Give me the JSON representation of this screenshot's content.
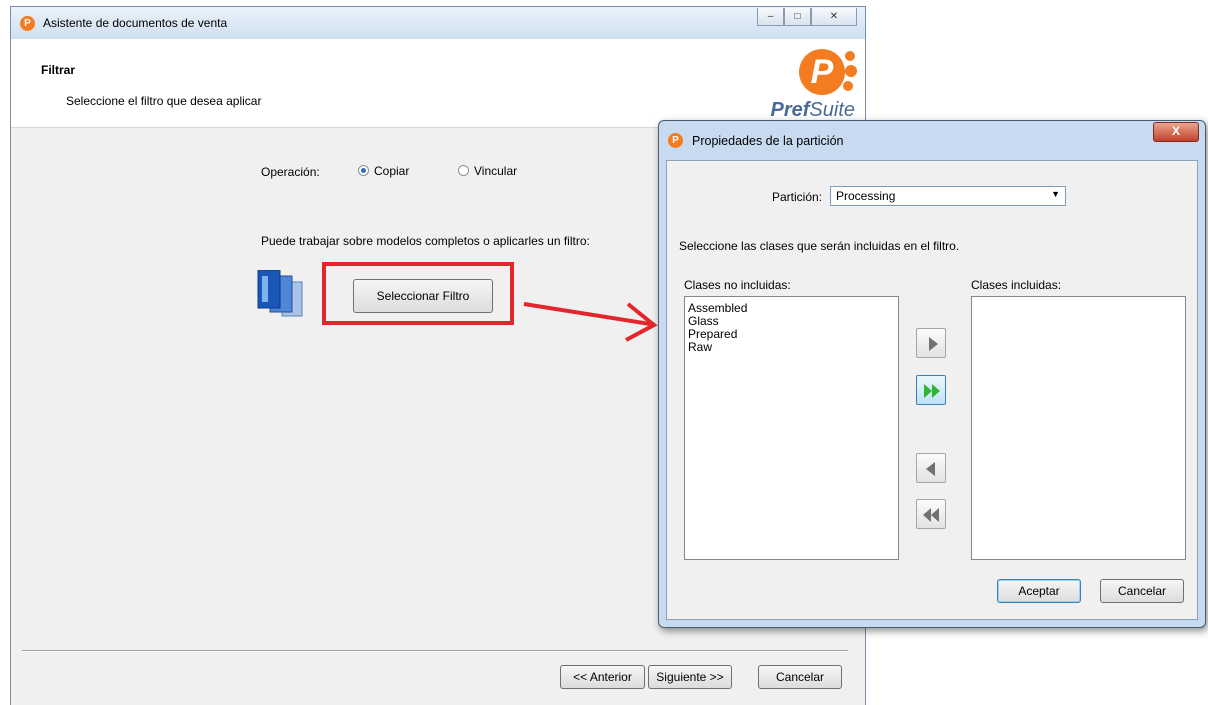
{
  "main_window": {
    "title": "Asistente de documentos de venta",
    "header": {
      "title": "Filtrar",
      "subtitle": "Seleccione el filtro que desea aplicar",
      "logo_text_bold": "Pref",
      "logo_text": "Suite"
    },
    "operation": {
      "label": "Operación:",
      "options": [
        {
          "label": "Copiar",
          "selected": true
        },
        {
          "label": "Vincular",
          "selected": false
        }
      ]
    },
    "filter_hint": "Puede trabajar sobre modelos completos o aplicarles un filtro:",
    "select_filter_label": "Seleccionar Filtro",
    "footer": {
      "prev_label": "<< Anterior",
      "next_label": "Siguiente >>",
      "cancel_label": "Cancelar"
    }
  },
  "dialog": {
    "title": "Propiedades de la partición",
    "close_label": "X",
    "partition": {
      "label": "Partición:",
      "value": "Processing"
    },
    "instruction": "Seleccione las clases que serán incluidas en el filtro.",
    "excluded": {
      "label": "Clases no incluidas:",
      "items": [
        "Assembled",
        "Glass",
        "Prepared",
        "Raw"
      ]
    },
    "included": {
      "label": "Clases incluidas:",
      "items": []
    },
    "ok_label": "Aceptar",
    "cancel_label": "Cancelar"
  },
  "colors": {
    "highlight": "#e3262b",
    "brand_orange": "#f47c20",
    "arrow_green": "#2fb52f"
  },
  "icons": [
    "prefsuite-app-icon",
    "minimize-icon",
    "maximize-icon",
    "close-icon",
    "documents-icon",
    "move-right-icon",
    "move-all-right-icon",
    "move-left-icon",
    "move-all-left-icon",
    "dropdown-arrow-icon"
  ]
}
